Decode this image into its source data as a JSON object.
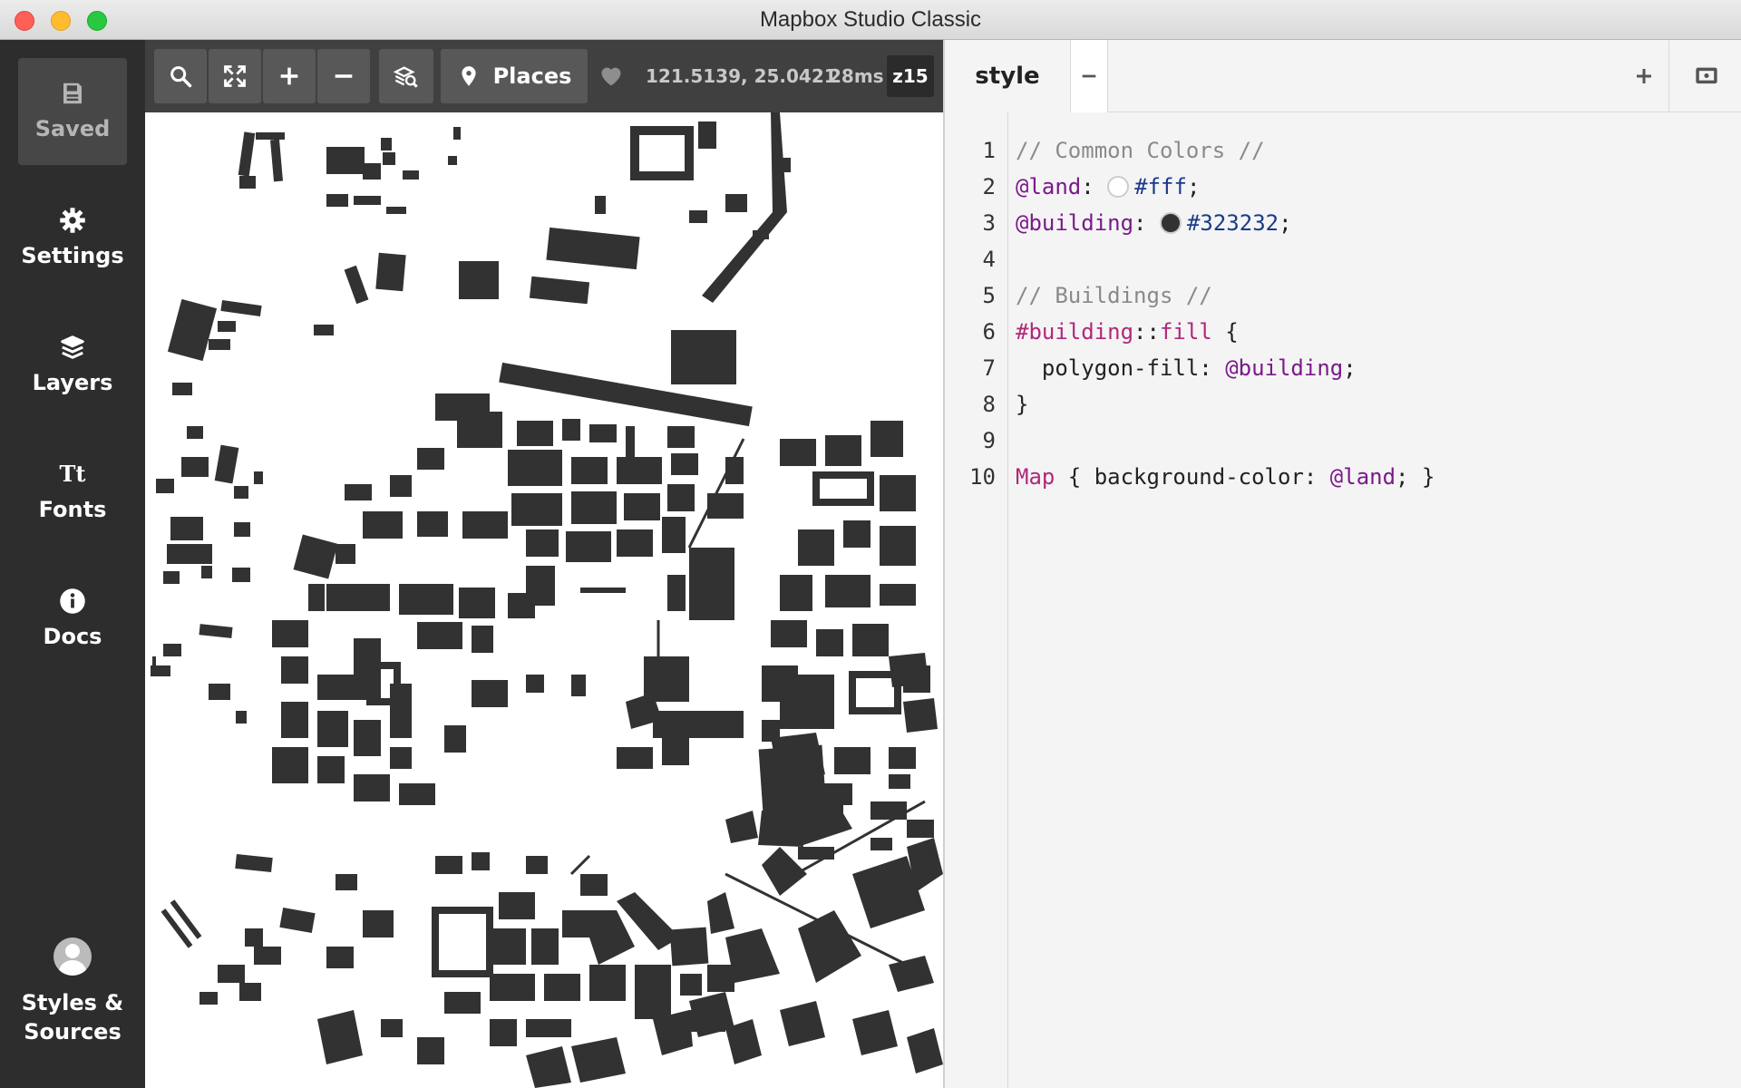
{
  "window": {
    "title": "Mapbox Studio Classic"
  },
  "sidebar": {
    "items": [
      {
        "label": "Saved",
        "icon": "save-icon",
        "active": true
      },
      {
        "label": "Settings",
        "icon": "gear-icon"
      },
      {
        "label": "Layers",
        "icon": "layers-icon"
      },
      {
        "label": "Fonts",
        "icon": "fonts-icon",
        "glyph": "Tt"
      },
      {
        "label": "Docs",
        "icon": "info-icon"
      },
      {
        "label": "Styles & Sources",
        "icon": "avatar"
      }
    ]
  },
  "map_toolbar": {
    "places_label": "Places",
    "coordinates": "121.5139, 25.0421",
    "render_time": "28ms",
    "zoom": "z15"
  },
  "editor": {
    "tab_label": "style",
    "lines": [
      {
        "n": "1",
        "text": "// Common Colors //"
      },
      {
        "n": "2",
        "var": "@land",
        "value": "#fff"
      },
      {
        "n": "3",
        "var": "@building",
        "value": "#323232"
      },
      {
        "n": "4"
      },
      {
        "n": "5",
        "text": "// Buildings //"
      },
      {
        "n": "6",
        "selector": "#building",
        "attachment": "::fill",
        "brace": " {"
      },
      {
        "n": "7",
        "prop": "  polygon-fill: ",
        "ref": "@building",
        "end": ";"
      },
      {
        "n": "8",
        "text": "}"
      },
      {
        "n": "9"
      },
      {
        "n": "10",
        "keyword": "Map",
        "rest": " { background-color: ",
        "ref": "@land",
        "end": "; }"
      }
    ]
  },
  "colors": {
    "land": "#fff",
    "building": "#323232",
    "sidebar_bg": "#2d2d2d",
    "toolbar_bg": "#404040"
  }
}
